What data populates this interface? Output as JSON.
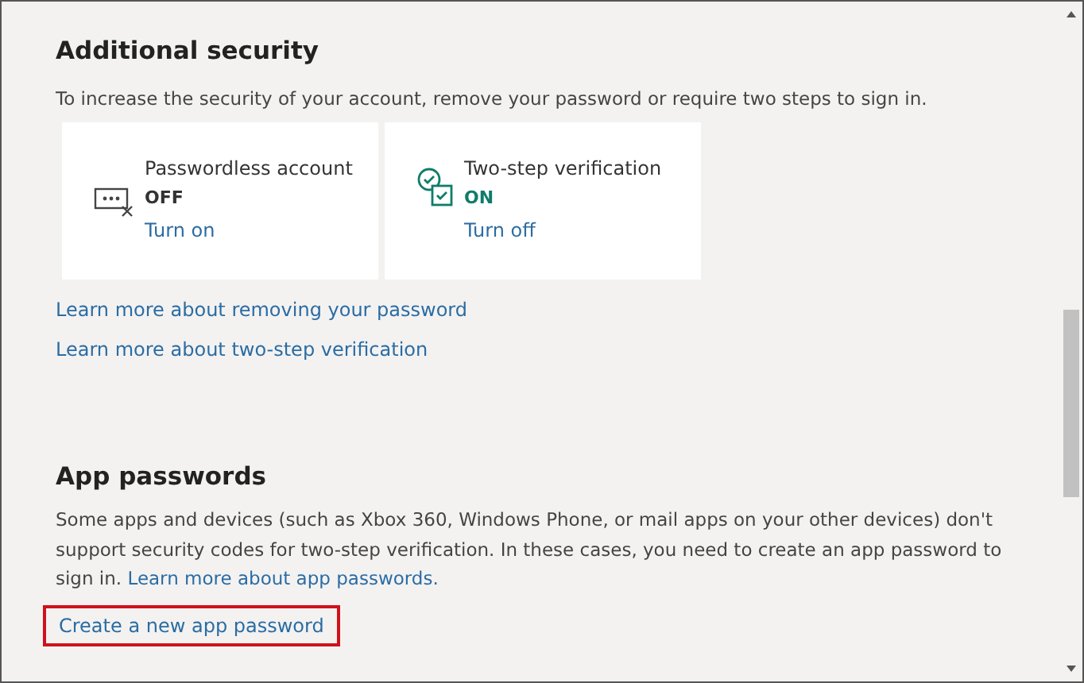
{
  "additional_security": {
    "heading": "Additional security",
    "description": "To increase the security of your account, remove your password or require two steps to sign in.",
    "cards": [
      {
        "kind": "passwordless",
        "title": "Passwordless account",
        "status": "OFF",
        "on": false,
        "link": "Turn on"
      },
      {
        "kind": "two-step",
        "title": "Two-step verification",
        "status": "ON",
        "on": true,
        "link": "Turn off"
      }
    ],
    "links": [
      "Learn more about removing your password",
      "Learn more about two-step verification"
    ]
  },
  "app_passwords": {
    "heading": "App passwords",
    "description": "Some apps and devices (such as Xbox 360, Windows Phone, or mail apps on your other devices) don't support security codes for two-step verification. In these cases, you need to create an app password to sign in.",
    "inline_link": "Learn more about app passwords.",
    "action": {
      "label": "Create a new app password",
      "highlighted": true
    }
  }
}
